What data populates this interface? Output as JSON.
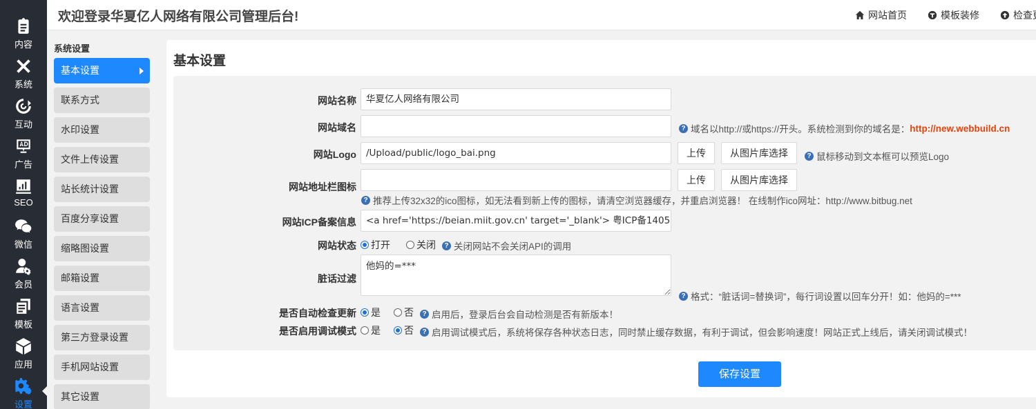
{
  "header": {
    "welcome": "欢迎登录华夏亿人网络有限公司管理后台!",
    "links": [
      {
        "label": "网站首页",
        "icon": "home-icon"
      },
      {
        "label": "模板装修",
        "icon": "palette-icon"
      },
      {
        "label": "检查更",
        "icon": "upload-icon"
      }
    ]
  },
  "rail": {
    "items": [
      {
        "label": "内容",
        "icon": "clipboard-icon"
      },
      {
        "label": "系统",
        "icon": "tools-icon"
      },
      {
        "label": "互动",
        "icon": "interact-icon"
      },
      {
        "label": "广告",
        "icon": "ad-icon"
      },
      {
        "label": "SEO",
        "icon": "chart-icon"
      },
      {
        "label": "微信",
        "icon": "wechat-icon"
      },
      {
        "label": "会员",
        "icon": "member-icon"
      },
      {
        "label": "模板",
        "icon": "template-icon"
      },
      {
        "label": "应用",
        "icon": "box-icon"
      },
      {
        "label": "设置",
        "icon": "gear-icon"
      }
    ],
    "active_index": 9
  },
  "subnav": {
    "title": "系统设置",
    "items": [
      "基本设置",
      "联系方式",
      "水印设置",
      "文件上传设置",
      "站长统计设置",
      "百度分享设置",
      "缩略图设置",
      "邮箱设置",
      "语言设置",
      "第三方登录设置",
      "手机网站设置",
      "其它设置"
    ],
    "active_index": 0
  },
  "panel": {
    "title": "基本设置",
    "fields": {
      "site_name": {
        "label": "网站名称",
        "value": "华夏亿人网络有限公司"
      },
      "site_domain": {
        "label": "网站域名",
        "value": "",
        "hint_prefix": "域名以http://或https://开头。系统检测到你的域名是：",
        "detected_domain": "http://new.webbuild.cn"
      },
      "site_logo": {
        "label": "网站Logo",
        "value": "/Upload/public/logo_bai.png",
        "upload": "上传",
        "library": "从图片库选择",
        "hint": "鼠标移动到文本框可以预览Logo"
      },
      "favicon": {
        "label": "网站地址栏图标",
        "value": "",
        "upload": "上传",
        "library": "从图片库选择",
        "hint": "推荐上传32x32的ico图标，如无法看到新上传的图标，请清空浏览器缓存，并重启浏览器！  在线制作ico网址：http://www.bitbug.net"
      },
      "icp": {
        "label": "网站ICP备案信息",
        "value": "<a href='https://beian.miit.gov.cn'  target='_blank'> 粤ICP备1405"
      },
      "status": {
        "label": "网站状态",
        "options": [
          "打开",
          "关闭"
        ],
        "selected": 0,
        "hint": "关闭网站不会关闭API的调用"
      },
      "filter": {
        "label": "脏话过滤",
        "value": "他妈的=***",
        "hint": "格式：“脏话词=替换词”，每行词设置以回车分开！如：他妈的=***"
      },
      "auto_update": {
        "label": "是否自动检查更新",
        "options": [
          "是",
          "否"
        ],
        "selected": 0,
        "hint": "启用后，登录后台会自动检测是否有新版本！"
      },
      "debug": {
        "label": "是否启用调试模式",
        "options": [
          "是",
          "否"
        ],
        "selected": 1,
        "hint": "启用调试模式后，系统将保存各种状态日志，同时禁止缓存数据，有利于调试，但会影响速度！网站正式上线后，请关闭调试模式！"
      }
    },
    "save_label": "保存设置"
  },
  "colors": {
    "accent": "#1e88ff",
    "rail_bg": "#282c34",
    "domain_highlight": "#e8420c"
  }
}
